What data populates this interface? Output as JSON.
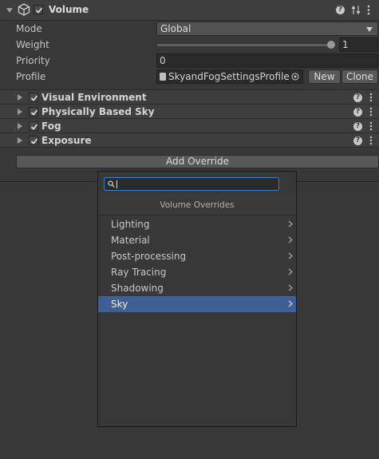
{
  "component": {
    "title": "Volume",
    "enabled": true
  },
  "properties": {
    "mode": {
      "label": "Mode",
      "value": "Global"
    },
    "weight": {
      "label": "Weight",
      "value": "1",
      "level": 1.0
    },
    "priority": {
      "label": "Priority",
      "value": "0"
    },
    "profile": {
      "label": "Profile",
      "value": "SkyandFogSettingsProfile",
      "new_label": "New",
      "clone_label": "Clone"
    }
  },
  "overrides": [
    {
      "name": "Visual Environment",
      "enabled": true
    },
    {
      "name": "Physically Based Sky",
      "enabled": true
    },
    {
      "name": "Fog",
      "enabled": true
    },
    {
      "name": "Exposure",
      "enabled": true
    }
  ],
  "add_override_label": "Add Override",
  "popup": {
    "search_value": "",
    "title": "Volume Overrides",
    "items": [
      {
        "label": "Lighting",
        "selected": false
      },
      {
        "label": "Material",
        "selected": false
      },
      {
        "label": "Post-processing",
        "selected": false
      },
      {
        "label": "Ray Tracing",
        "selected": false
      },
      {
        "label": "Shadowing",
        "selected": false
      },
      {
        "label": "Sky",
        "selected": true
      }
    ]
  },
  "icons": {
    "component": "cube-icon",
    "help": "help-icon",
    "presets": "sliders-icon",
    "menu": "kebab-menu-icon",
    "search": "search-icon",
    "object_picker": "target-icon"
  },
  "colors": {
    "background": "#383838",
    "selected_item": "#3e5f96",
    "search_focus": "#3d7fc7"
  }
}
